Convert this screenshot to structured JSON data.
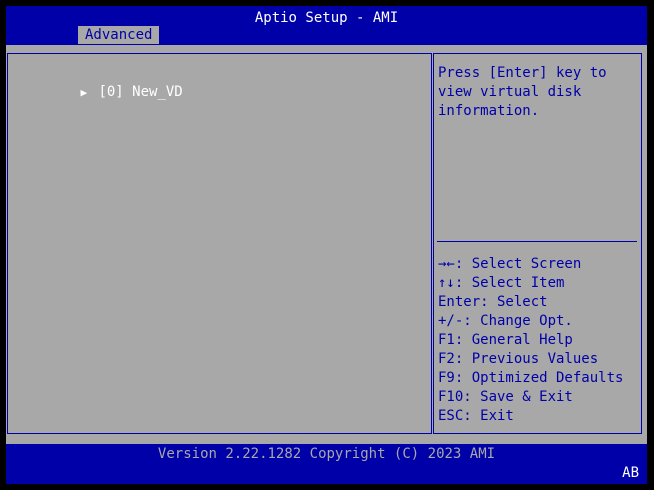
{
  "window": {
    "title": "Aptio Setup - AMI"
  },
  "tabs": [
    {
      "label": "Advanced",
      "selected": true
    }
  ],
  "menu": {
    "items": [
      {
        "arrow_icon": "triangle-right-icon",
        "label": "[0] New_VD"
      }
    ]
  },
  "help_panel": {
    "lines": [
      "Press [Enter] key to",
      "view virtual disk",
      "information."
    ]
  },
  "key_help": {
    "lines": [
      "→←: Select Screen",
      "↑↓: Select Item",
      "Enter: Select",
      "+/-: Change Opt.",
      "F1: General Help",
      "F2: Previous Values",
      "F9: Optimized Defaults",
      "F10: Save & Exit",
      "ESC: Exit"
    ]
  },
  "footer": {
    "version": "Version 2.22.1282 Copyright (C) 2023 AMI",
    "code": "AB"
  },
  "colors": {
    "background_blue": "#0000a8",
    "panel_gray": "#a8a8a8",
    "text_white": "#ffffff",
    "outer_black": "#000000"
  }
}
